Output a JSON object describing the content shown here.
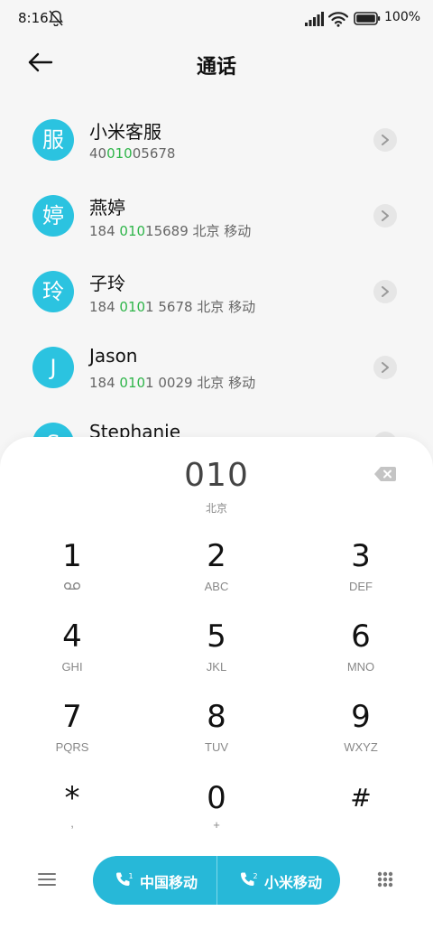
{
  "status": {
    "time": "8:16",
    "battery": "100%"
  },
  "header": {
    "title": "通话"
  },
  "contacts": [
    {
      "avatar": "服",
      "name": "小米客服",
      "num_pre": "40",
      "num_hl": "010",
      "num_post": "05678"
    },
    {
      "avatar": "婷",
      "name": "燕婷",
      "num_pre": "184 ",
      "num_hl": "010",
      "num_post": "15689  北京 移动"
    },
    {
      "avatar": "玲",
      "name": "子玲",
      "num_pre": "184 ",
      "num_hl": "010",
      "num_post": "1 5678  北京 移动"
    },
    {
      "avatar": "J",
      "name": "Jason",
      "num_pre": "184 ",
      "num_hl": "010",
      "num_post": "1 0029  北京 移动"
    },
    {
      "avatar": "S",
      "name": "Stephanie",
      "num_pre": "",
      "num_hl": "",
      "num_post": ""
    }
  ],
  "dial": {
    "display": "010",
    "location": "北京",
    "keys": [
      {
        "digit": "1",
        "letters": ""
      },
      {
        "digit": "2",
        "letters": "ABC"
      },
      {
        "digit": "3",
        "letters": "DEF"
      },
      {
        "digit": "4",
        "letters": "GHI"
      },
      {
        "digit": "5",
        "letters": "JKL"
      },
      {
        "digit": "6",
        "letters": "MNO"
      },
      {
        "digit": "7",
        "letters": "PQRS"
      },
      {
        "digit": "8",
        "letters": "TUV"
      },
      {
        "digit": "9",
        "letters": "WXYZ"
      },
      {
        "digit": "*",
        "letters": ","
      },
      {
        "digit": "0",
        "letters": "+"
      },
      {
        "digit": "#",
        "letters": ""
      }
    ]
  },
  "call": {
    "sim1_label": "中国移动",
    "sim2_label": "小米移动"
  },
  "colors": {
    "accent": "#27b8d8",
    "avatar": "#2bc3e0",
    "match": "#2fb54a"
  },
  "icons": [
    "bell-off-icon",
    "signal-icon",
    "wifi-icon",
    "battery-icon",
    "back-arrow-icon",
    "chevron-right-icon",
    "backspace-icon",
    "voicemail-icon",
    "menu-icon",
    "phone-icon",
    "keypad-icon"
  ]
}
